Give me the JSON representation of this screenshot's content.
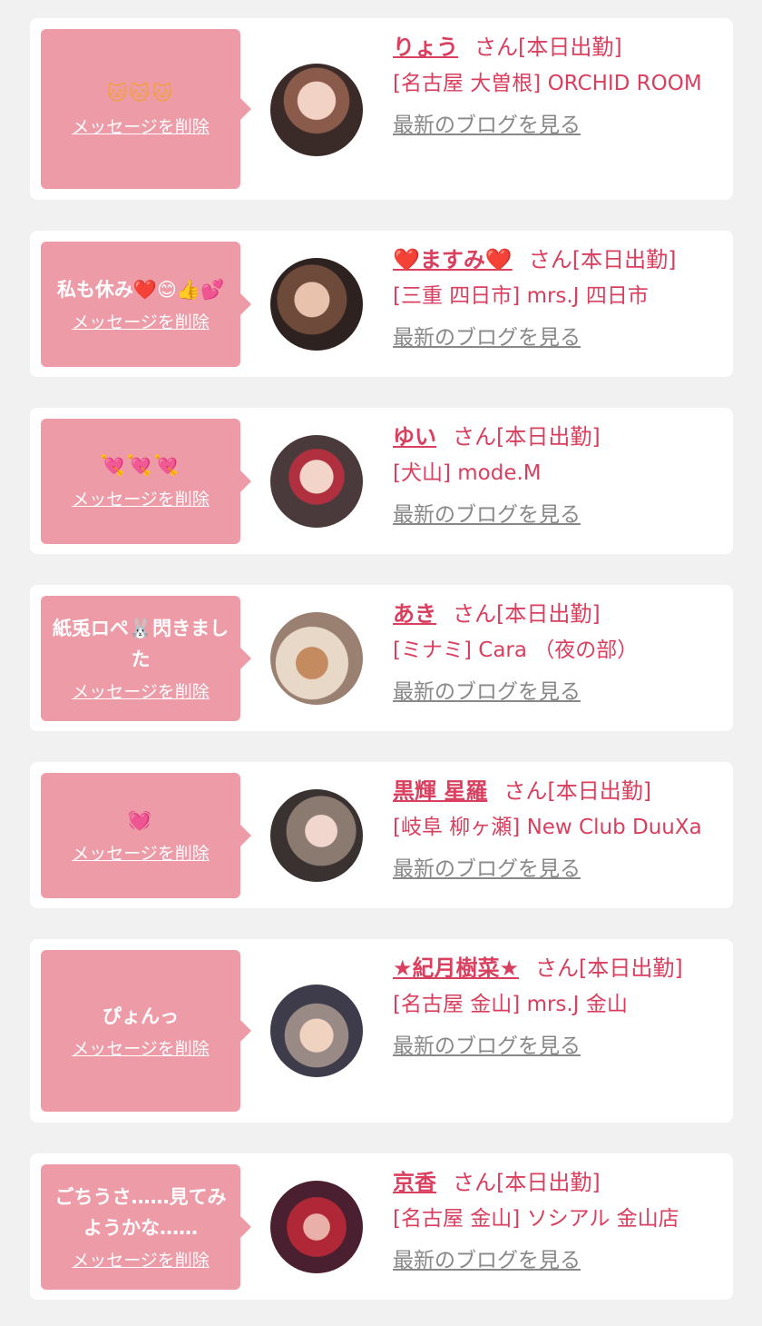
{
  "cards": [
    {
      "message": "🐱🐱🐱",
      "delete_label": "メッセージを削除",
      "name": "りょう",
      "suffix": "さん[本日出勤]",
      "shop": "[名古屋 大曽根] ORCHID ROOM",
      "blog_label": "最新のブログを見る"
    },
    {
      "message": "私も休み❤️😊👍💕",
      "delete_label": "メッセージを削除",
      "name": "❤️ますみ❤️",
      "suffix": "さん[本日出勤]",
      "shop": "[三重 四日市] mrs.J 四日市",
      "blog_label": "最新のブログを見る"
    },
    {
      "message": "💘💘💘",
      "delete_label": "メッセージを削除",
      "name": "ゆい",
      "suffix": "さん[本日出勤]",
      "shop": "[犬山] mode.M",
      "blog_label": "最新のブログを見る"
    },
    {
      "message": "紙兎ロペ🐰閃きました",
      "delete_label": "メッセージを削除",
      "name": "あき",
      "suffix": "さん[本日出勤]",
      "shop": "[ミナミ] Cara （夜の部）",
      "blog_label": "最新のブログを見る"
    },
    {
      "message": "💓",
      "delete_label": "メッセージを削除",
      "name": "黒輝 星羅",
      "suffix": "さん[本日出勤]",
      "shop": "[岐阜 柳ヶ瀬] New Club DuuXa",
      "blog_label": "最新のブログを見る"
    },
    {
      "message": "ぴょんっ",
      "delete_label": "メッセージを削除",
      "name": "★紀月樹菜★",
      "suffix": "さん[本日出勤]",
      "shop": "[名古屋 金山] mrs.J 金山",
      "blog_label": "最新のブログを見る"
    },
    {
      "message": "ごちうさ……見てみようかな……",
      "delete_label": "メッセージを削除",
      "name": "京香",
      "suffix": "さん[本日出勤]",
      "shop": "[名古屋 金山] ソシアル 金山店",
      "blog_label": "最新のブログを見る"
    }
  ],
  "colors": {
    "accent": "#d9405f",
    "bubble": "#ee9ba8",
    "link_gray": "#888888",
    "background": "#f1f1f1"
  }
}
